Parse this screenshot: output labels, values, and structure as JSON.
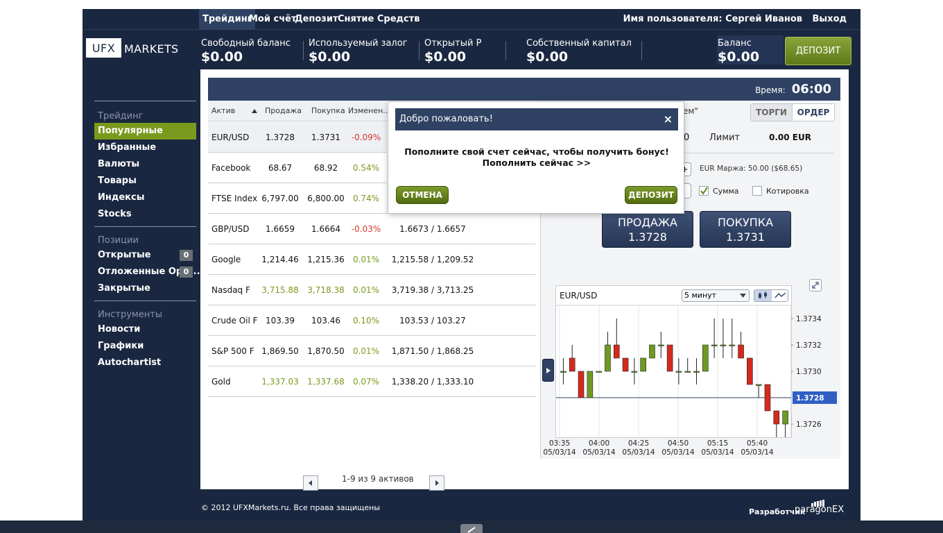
{
  "nav": {
    "items": [
      "Трейдинг",
      "Мой счёт",
      "Депозит",
      "Снятие Средств"
    ],
    "user_label": "Имя пользователя: Сергей Иванов",
    "logout": "Выход"
  },
  "logo": {
    "box": "UFX",
    "rest": "MARKETS"
  },
  "stats": [
    {
      "label": "Свободный баланс",
      "value": "$0.00"
    },
    {
      "label": "Используемый залог",
      "value": "$0.00"
    },
    {
      "label": "Открытый Р",
      "value": "$0.00"
    },
    {
      "label": "Собственный капитал",
      "value": "$0.00"
    }
  ],
  "balance": {
    "label": "Баланс",
    "value": "$0.00"
  },
  "deposit_button": "ДЕПОЗИТ",
  "sidebar": {
    "trading_head": "Трейдинг",
    "trading_items": [
      "Популярные",
      "Избранные",
      "Валюты",
      "Товары",
      "Индексы",
      "Stocks"
    ],
    "positions_head": "Позиции",
    "positions_items": [
      {
        "label": "Открытые",
        "badge": "0"
      },
      {
        "label": "Отложенные Орд...",
        "badge": "0"
      },
      {
        "label": "Закрытые",
        "badge": ""
      }
    ],
    "tools_head": "Инструменты",
    "tools_items": [
      "Новости",
      "Графики",
      "Autochartist"
    ]
  },
  "timer": {
    "label": "Время:",
    "value": "06:00"
  },
  "table": {
    "headers": [
      "Актив",
      "Продажа",
      "Покупка",
      "Изменен..."
    ],
    "sort_icon": "triangle-up-icon",
    "rows": [
      {
        "asset": "EUR/USD",
        "sell": "1.3728",
        "buy": "1.3731",
        "change": "-0.09%",
        "range": "",
        "sell_green": false,
        "buy_green": false
      },
      {
        "asset": "Facebook",
        "sell": "68.67",
        "buy": "68.92",
        "change": "0.54%",
        "range": "",
        "sell_green": false,
        "buy_green": false
      },
      {
        "asset": "FTSE Index",
        "sell": "6,797.00",
        "buy": "6,800.00",
        "change": "0.74%",
        "range": "",
        "sell_green": false,
        "buy_green": false
      },
      {
        "asset": "GBP/USD",
        "sell": "1.6659",
        "buy": "1.6664",
        "change": "-0.03%",
        "range": "1.6673 / 1.6657",
        "sell_green": false,
        "buy_green": false
      },
      {
        "asset": "Google",
        "sell": "1,214.46",
        "buy": "1,215.36",
        "change": "0.01%",
        "range": "1,215.58 / 1,209.52",
        "sell_green": false,
        "buy_green": false
      },
      {
        "asset": "Nasdaq F",
        "sell": "3,715.88",
        "buy": "3,718.38",
        "change": "0.01%",
        "range": "3,719.38 / 3,713.25",
        "sell_green": true,
        "buy_green": true
      },
      {
        "asset": "Crude Oil F",
        "sell": "103.39",
        "buy": "103.46",
        "change": "0.10%",
        "range": "103.53 / 103.27",
        "sell_green": false,
        "buy_green": false
      },
      {
        "asset": "S&P 500 F",
        "sell": "1,869.50",
        "buy": "1,870.50",
        "change": "0.01%",
        "range": "1,871.50 / 1,868.25",
        "sell_green": false,
        "buy_green": false
      },
      {
        "asset": "Gold",
        "sell": "1,337.03",
        "buy": "1,337.68",
        "change": "0.07%",
        "range": "1,338.20 / 1,333.10",
        "sell_green": true,
        "buy_green": true
      }
    ]
  },
  "panel": {
    "partial_title": "ем\"",
    "tabs": [
      "ТОРГИ",
      "ОРДЕР"
    ],
    "partial_value": "0",
    "limit_label": "Лимит",
    "limit_value": "0.00 EUR",
    "margin_text": "EUR Маржа: 50.00 ($68.65)",
    "plus": "+",
    "amount_label": "Сумма",
    "quote_label": "Котировка",
    "sell_label": "ПРОДАЖА",
    "sell_price": "1.3728",
    "buy_label": "ПОКУПКА",
    "buy_price": "1.3731"
  },
  "chart_data": {
    "type": "candlestick",
    "title": "EUR/USD",
    "interval": "5 минут",
    "ylim": [
      1.3725,
      1.3735
    ],
    "y_ticks": [
      "1.3734",
      "1.3732",
      "1.3730",
      "1.3728",
      "1.3726"
    ],
    "current": "1.3728",
    "x_ticks": [
      {
        "time": "03:35",
        "date": "05/03/14"
      },
      {
        "time": "04:00",
        "date": "05/03/14"
      },
      {
        "time": "04:25",
        "date": "05/03/14"
      },
      {
        "time": "04:50",
        "date": "05/03/14"
      },
      {
        "time": "05:15",
        "date": "05/03/14"
      },
      {
        "time": "05:40",
        "date": "05/03/14"
      }
    ],
    "candles": [
      {
        "o": 1.373,
        "h": 1.3731,
        "l": 1.3729,
        "c": 1.373
      },
      {
        "o": 1.3731,
        "h": 1.3732,
        "l": 1.373,
        "c": 1.373
      },
      {
        "o": 1.373,
        "h": 1.373,
        "l": 1.3728,
        "c": 1.3728
      },
      {
        "o": 1.3728,
        "h": 1.373,
        "l": 1.3728,
        "c": 1.373
      },
      {
        "o": 1.373,
        "h": 1.373,
        "l": 1.373,
        "c": 1.373
      },
      {
        "o": 1.373,
        "h": 1.3733,
        "l": 1.373,
        "c": 1.3732
      },
      {
        "o": 1.3732,
        "h": 1.3734,
        "l": 1.3731,
        "c": 1.3731
      },
      {
        "o": 1.3731,
        "h": 1.3731,
        "l": 1.373,
        "c": 1.373
      },
      {
        "o": 1.373,
        "h": 1.3731,
        "l": 1.3729,
        "c": 1.373
      },
      {
        "o": 1.373,
        "h": 1.3731,
        "l": 1.373,
        "c": 1.3731
      },
      {
        "o": 1.3731,
        "h": 1.3732,
        "l": 1.3731,
        "c": 1.3732
      },
      {
        "o": 1.3732,
        "h": 1.3733,
        "l": 1.3731,
        "c": 1.3732
      },
      {
        "o": 1.3732,
        "h": 1.3732,
        "l": 1.373,
        "c": 1.373
      },
      {
        "o": 1.373,
        "h": 1.3731,
        "l": 1.3729,
        "c": 1.373
      },
      {
        "o": 1.373,
        "h": 1.3731,
        "l": 1.373,
        "c": 1.373
      },
      {
        "o": 1.373,
        "h": 1.3731,
        "l": 1.3729,
        "c": 1.373
      },
      {
        "o": 1.373,
        "h": 1.3732,
        "l": 1.373,
        "c": 1.3732
      },
      {
        "o": 1.3732,
        "h": 1.3734,
        "l": 1.3731,
        "c": 1.3732
      },
      {
        "o": 1.3732,
        "h": 1.3734,
        "l": 1.3731,
        "c": 1.3732
      },
      {
        "o": 1.3732,
        "h": 1.3734,
        "l": 1.3731,
        "c": 1.3732
      },
      {
        "o": 1.3732,
        "h": 1.3733,
        "l": 1.3731,
        "c": 1.3731
      },
      {
        "o": 1.3731,
        "h": 1.3731,
        "l": 1.3729,
        "c": 1.3729
      },
      {
        "o": 1.3729,
        "h": 1.3729,
        "l": 1.3728,
        "c": 1.3729
      },
      {
        "o": 1.3729,
        "h": 1.3729,
        "l": 1.3727,
        "c": 1.3727
      },
      {
        "o": 1.3727,
        "h": 1.3727,
        "l": 1.3725,
        "c": 1.3726
      },
      {
        "o": 1.3726,
        "h": 1.3727,
        "l": 1.3725,
        "c": 1.3727
      }
    ]
  },
  "modal": {
    "title": "Добро пожаловать!",
    "close": "×",
    "text": "Пополните свой счет сейчас, чтобы получить бонус! Пополнить сейчас >>",
    "cancel": "ОТМЕНА",
    "deposit": "ДЕПОЗИТ"
  },
  "pager": {
    "text": "1-9 из  9 активов"
  },
  "footer": {
    "copyright": "© 2012 UFXMarkets.ru. Все права защищены",
    "developer": "Разработчик",
    "brand": "paragonEX"
  },
  "colors": {
    "navy": "#1a2740",
    "header": "#2f4263",
    "green": "#7a9a1d",
    "red": "#d43a2a"
  }
}
